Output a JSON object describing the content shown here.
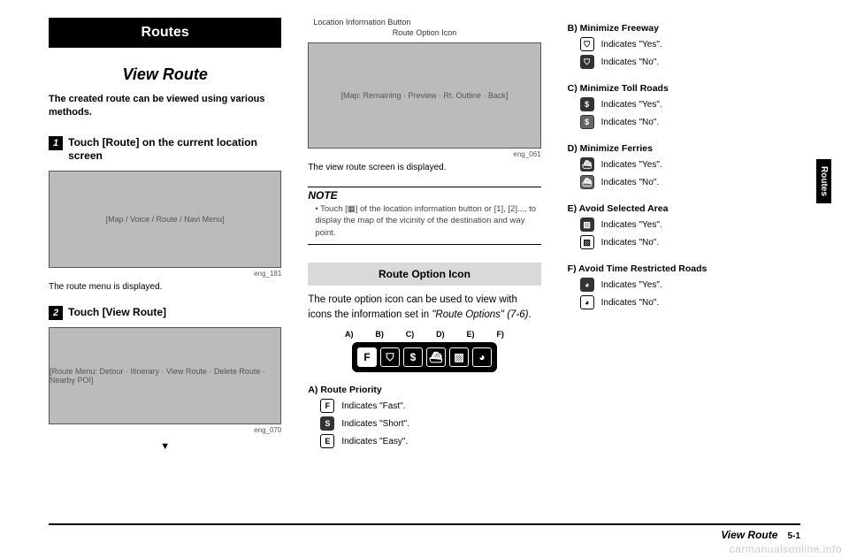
{
  "side_tab": "Routes",
  "section_banner": "Routes",
  "page_title": "View Route",
  "intro": "The created route can be viewed using various methods.",
  "step1_num": "1",
  "step1_text": "Touch [Route] on the current location screen",
  "img1_caption": "eng_181",
  "route_menu_displayed": "The route menu is displayed.",
  "step2_num": "2",
  "step2_text": "Touch [View Route]",
  "img2_caption": "eng_070",
  "col2": {
    "loc_info_button": "Location Information Button",
    "route_option_icon_label": "Route Option Icon",
    "img3_caption": "eng_061",
    "view_route_displayed": "The view route screen is displayed.",
    "note_head": "NOTE",
    "note_body": "• Touch [▦] of the location information button or [1], [2]..., to display the map of the vicinity of the destination and way point.",
    "sub_banner": "Route Option Icon",
    "sub_body_1": "The route option icon can be used to view with icons the information set in ",
    "sub_body_2": "\"Route Options\" (7-6)",
    "sub_body_3": ".",
    "labels": {
      "a": "A)",
      "b": "B)",
      "c": "C)",
      "d": "D)",
      "e": "E)",
      "f": "F)"
    },
    "section_a_title": "A) Route Priority",
    "a_fast": "Indicates \"Fast\".",
    "a_short": "Indicates \"Short\".",
    "a_easy": "Indicates \"Easy\"."
  },
  "col3": {
    "b_title": "B) Minimize Freeway",
    "c_title": "C) Minimize Toll Roads",
    "d_title": "D) Minimize Ferries",
    "e_title": "E) Avoid Selected Area",
    "f_title": "F) Avoid Time Restricted Roads",
    "yes": "Indicates \"Yes\".",
    "no": "Indicates \"No\"."
  },
  "footer": {
    "title": "View Route",
    "page": "5-1"
  },
  "watermark": "carmanualsonline.info",
  "icons": {
    "f": "F",
    "s": "S",
    "e": "E"
  },
  "screenshot_labels": {
    "s1": "[Map / Voice / Route / Navi Menu]",
    "s2": "[Route Menu: Detour · Itinerary · View Route · Delete Route · Nearby POI]",
    "s3": "[Map: Remaining · Preview · Rt. Outline · Back]"
  }
}
